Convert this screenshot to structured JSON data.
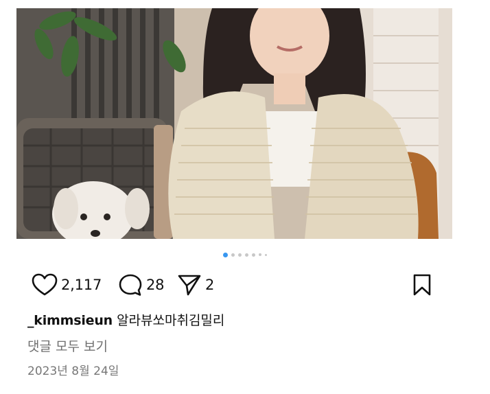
{
  "post": {
    "likes": "2,117",
    "comments": "28",
    "shares": "2",
    "username": "_kimmsieun",
    "caption": "알라뷰쏘마취김밀리",
    "view_comments": "댓글 모두 보기",
    "date": "2023년 8월 24일"
  },
  "carousel": {
    "active_index": 0,
    "dots_visible": 7
  },
  "icons": {
    "like": "heart-outline-icon",
    "comment": "speech-bubble-icon",
    "share": "paper-plane-icon",
    "save": "bookmark-icon"
  },
  "colors": {
    "active_dot": "#3897f0",
    "inactive_dot": "#c8c8c8",
    "secondary_text": "#6f6f6f"
  }
}
